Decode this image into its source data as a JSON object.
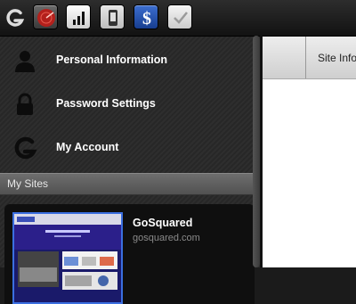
{
  "toolbar": {
    "logo_icon": "gosquared-logo-icon",
    "buttons": [
      {
        "name": "realtime-radar-icon",
        "accent": "#c8231f"
      },
      {
        "name": "bar-chart-icon",
        "accent": "#ffffff"
      },
      {
        "name": "phone-icon",
        "accent": "#dcdcdc"
      },
      {
        "name": "dollar-icon",
        "accent": "#1f4fb0"
      },
      {
        "name": "checkmark-icon",
        "accent": "#e0e0e0"
      }
    ]
  },
  "sidebar": {
    "items": [
      {
        "label": "Personal Information",
        "icon": "person-icon"
      },
      {
        "label": "Password Settings",
        "icon": "lock-icon"
      },
      {
        "label": "My Account",
        "icon": "gosquared-logo-icon"
      }
    ],
    "section_title": "My Sites",
    "sites": [
      {
        "name": "GoSquared",
        "url": "gosquared.com"
      }
    ]
  },
  "content": {
    "tab_label": "Site Info"
  }
}
